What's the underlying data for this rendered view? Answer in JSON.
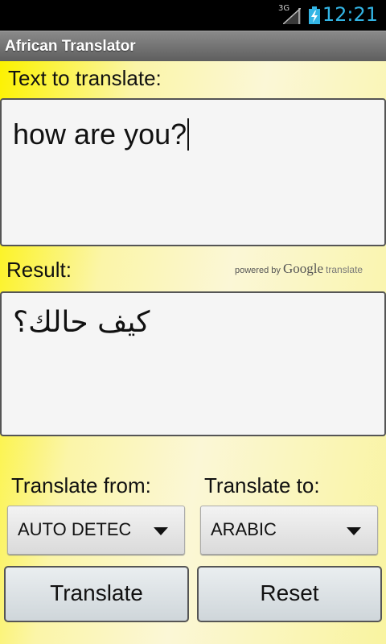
{
  "status_bar": {
    "network": "3G",
    "time": "12:21",
    "colors": {
      "clock": "#33b5e5",
      "battery": "#33b5e5"
    }
  },
  "app": {
    "title": "African Translator"
  },
  "input": {
    "label": "Text to translate:",
    "value": "how are you?"
  },
  "result": {
    "label": "Result:",
    "value": "كيف حالك؟",
    "powered_by": "powered by",
    "brand": "Google",
    "brand_suffix": "translate"
  },
  "from": {
    "label": "Translate from:",
    "selected": "AUTO DETECT"
  },
  "to": {
    "label": "Translate to:",
    "selected": "ARABIC"
  },
  "buttons": {
    "translate": "Translate",
    "reset": "Reset"
  }
}
